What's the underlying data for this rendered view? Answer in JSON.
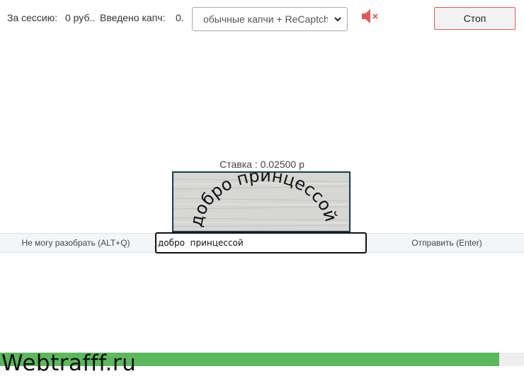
{
  "stats": {
    "session_label": "За сессию:",
    "session_value": "0 руб..",
    "entered_label": "Введено капч:",
    "entered_value": "0."
  },
  "mode_select": {
    "selected": "обычные капчи + ReCaptcha"
  },
  "mute_icon": "speaker-muted-icon",
  "stop_label": "Стоп",
  "rate": {
    "text": "Ставка : 0.02500 р"
  },
  "captcha": {
    "text": "добро принцессой"
  },
  "actions": {
    "cant_read_label": "Не могу разобрать (ALT+Q)",
    "answer_value": "добро  принцессой",
    "submit_label": "Отправить (Enter)"
  },
  "progress": {
    "fraction": 0.953
  },
  "watermark": "Webtrafff.ru",
  "colors": {
    "progress": "#5cb85c",
    "stop_border": "#e05a5a",
    "mute_icon": "#e05a5a",
    "captcha_border": "#1f3a52"
  }
}
